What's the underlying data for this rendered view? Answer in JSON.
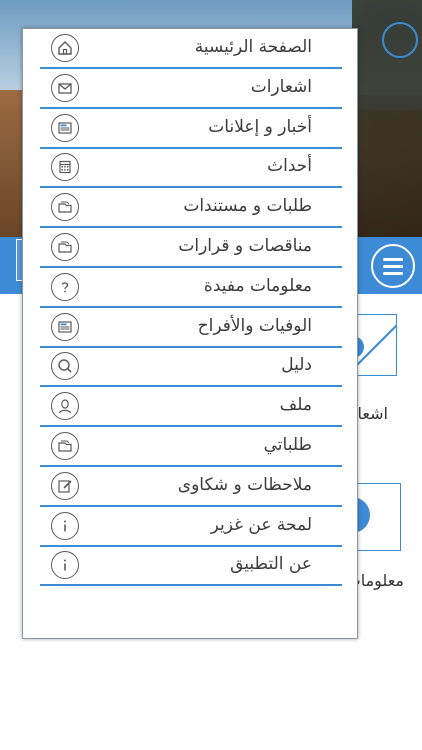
{
  "menu": {
    "items": [
      {
        "label": "الصفحة الرئيسية",
        "icon": "home-icon"
      },
      {
        "label": "اشعارات",
        "icon": "envelope-icon"
      },
      {
        "label": "أخبار و إعلانات",
        "icon": "news-icon"
      },
      {
        "label": "أحداث",
        "icon": "calendar-icon"
      },
      {
        "label": "طلبات و مستندات",
        "icon": "documents-icon"
      },
      {
        "label": "مناقصات و قرارات",
        "icon": "documents-icon"
      },
      {
        "label": "معلومات مفيدة",
        "icon": "question-icon"
      },
      {
        "label": "الوفيات والأفراح",
        "icon": "news-icon"
      },
      {
        "label": "دليل",
        "icon": "search-icon"
      },
      {
        "label": "ملف",
        "icon": "user-icon"
      },
      {
        "label": "طلباتي",
        "icon": "documents-icon"
      },
      {
        "label": "ملاحظات و شكاوى",
        "icon": "edit-icon"
      },
      {
        "label": "لمحة عن غزير",
        "icon": "info-icon"
      },
      {
        "label": "عن التطبيق",
        "icon": "info-icon"
      }
    ]
  },
  "background": {
    "label_1": "اشعارات",
    "label_2": "معلومات مفيدة"
  },
  "colors": {
    "accent": "#3d8bd6",
    "text": "#3c3c3c"
  }
}
